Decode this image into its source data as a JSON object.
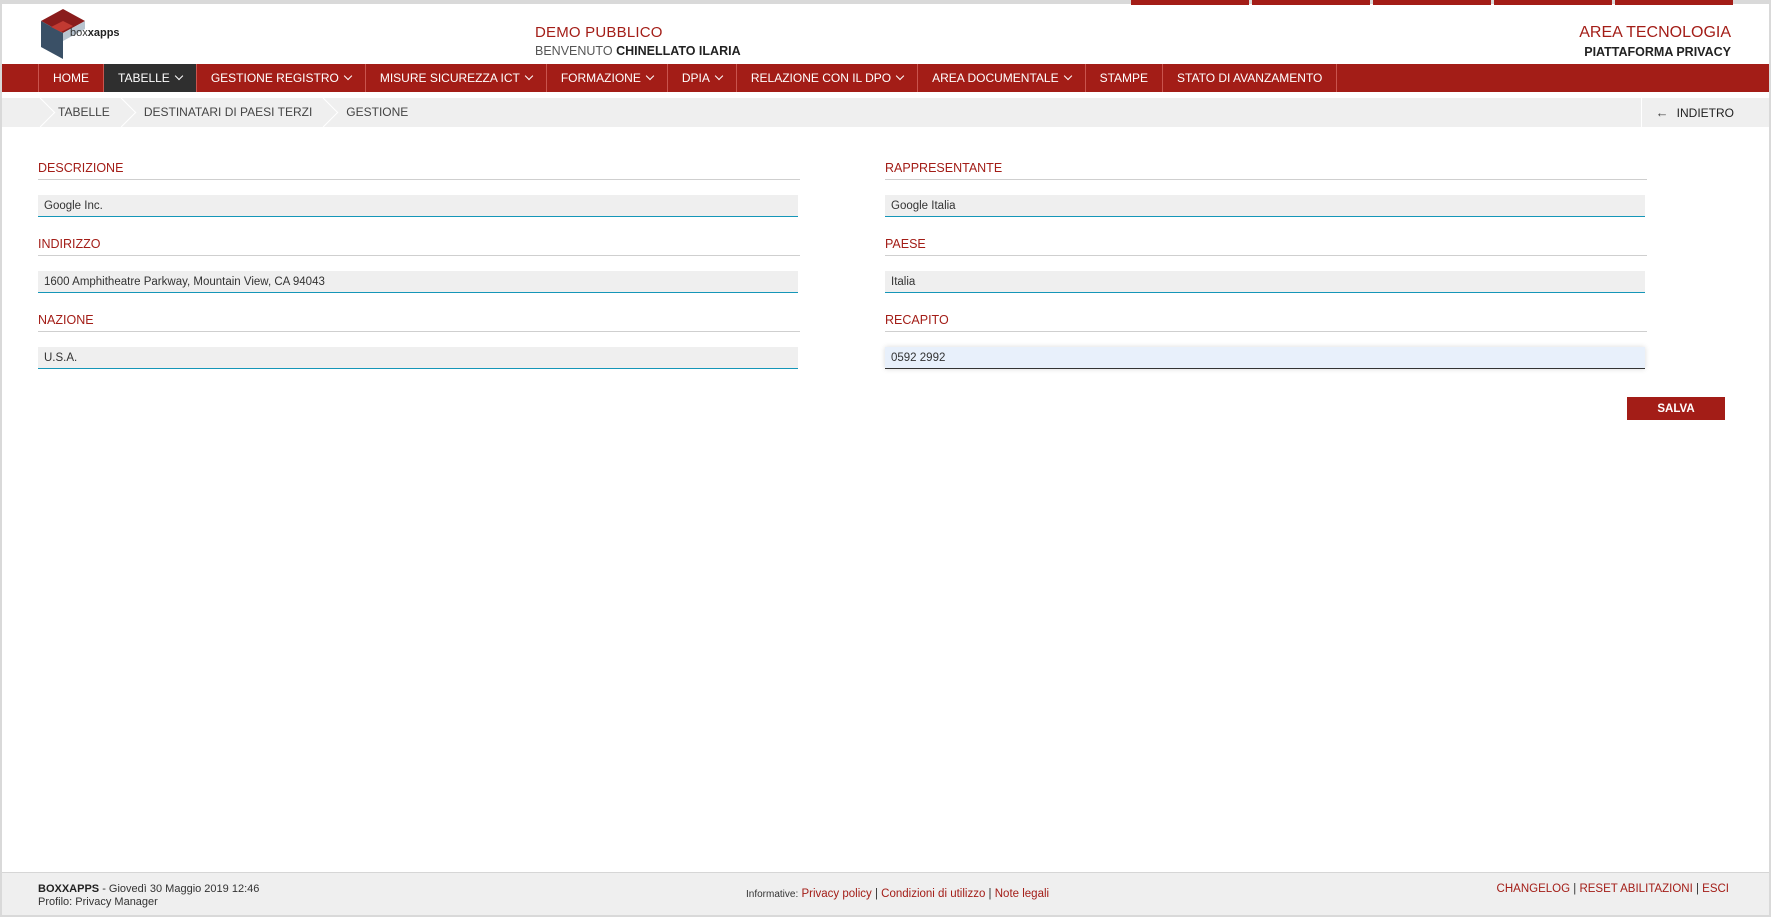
{
  "header": {
    "logo_text_light": "box",
    "logo_text_bold": "xapps",
    "demo_title": "DEMO PUBBLICO",
    "welcome_prefix": "BENVENUTO",
    "user_name": "CHINELLATO ILARIA",
    "area_title": "AREA TECNOLOGIA",
    "platform": "PIATTAFORMA PRIVACY"
  },
  "nav": {
    "items": [
      {
        "label": "HOME",
        "dropdown": false
      },
      {
        "label": "TABELLE",
        "dropdown": true,
        "active": true
      },
      {
        "label": "GESTIONE REGISTRO",
        "dropdown": true
      },
      {
        "label": "MISURE SICUREZZA ICT",
        "dropdown": true
      },
      {
        "label": "FORMAZIONE",
        "dropdown": true
      },
      {
        "label": "DPIA",
        "dropdown": true
      },
      {
        "label": "RELAZIONE CON IL DPO",
        "dropdown": true
      },
      {
        "label": "AREA DOCUMENTALE",
        "dropdown": true
      },
      {
        "label": "STAMPE",
        "dropdown": false
      },
      {
        "label": "STATO DI AVANZAMENTO",
        "dropdown": false
      }
    ]
  },
  "breadcrumb": {
    "items": [
      "TABELLE",
      "DESTINATARI DI PAESI TERZI",
      "GESTIONE"
    ],
    "back_label": "INDIETRO"
  },
  "form": {
    "descrizione": {
      "label": "DESCRIZIONE",
      "value": "Google Inc."
    },
    "rappresentante": {
      "label": "RAPPRESENTANTE",
      "value": "Google Italia"
    },
    "indirizzo": {
      "label": "INDIRIZZO",
      "value": "1600 Amphitheatre Parkway, Mountain View, CA 94043"
    },
    "paese": {
      "label": "PAESE",
      "value": "Italia"
    },
    "nazione": {
      "label": "NAZIONE",
      "value": "U.S.A."
    },
    "recapito": {
      "label": "RECAPITO",
      "value": "0592 2992"
    },
    "save_label": "SALVA"
  },
  "footer": {
    "brand": "BOXXAPPS",
    "datetime": " - Giovedì 30 Maggio 2019 12:46",
    "profile": "Profilo: Privacy Manager",
    "informative_label": "Informative:",
    "privacy_policy": "Privacy policy",
    "conditions": "Condizioni di utilizzo",
    "legal_notes": "Note legali",
    "changelog": "CHANGELOG",
    "reset": "RESET ABILITAZIONI",
    "exit": "ESCI"
  },
  "colors": {
    "brand_red": "#a31d17",
    "active_nav": "#2f2f2f",
    "input_underline": "#1596b8"
  }
}
